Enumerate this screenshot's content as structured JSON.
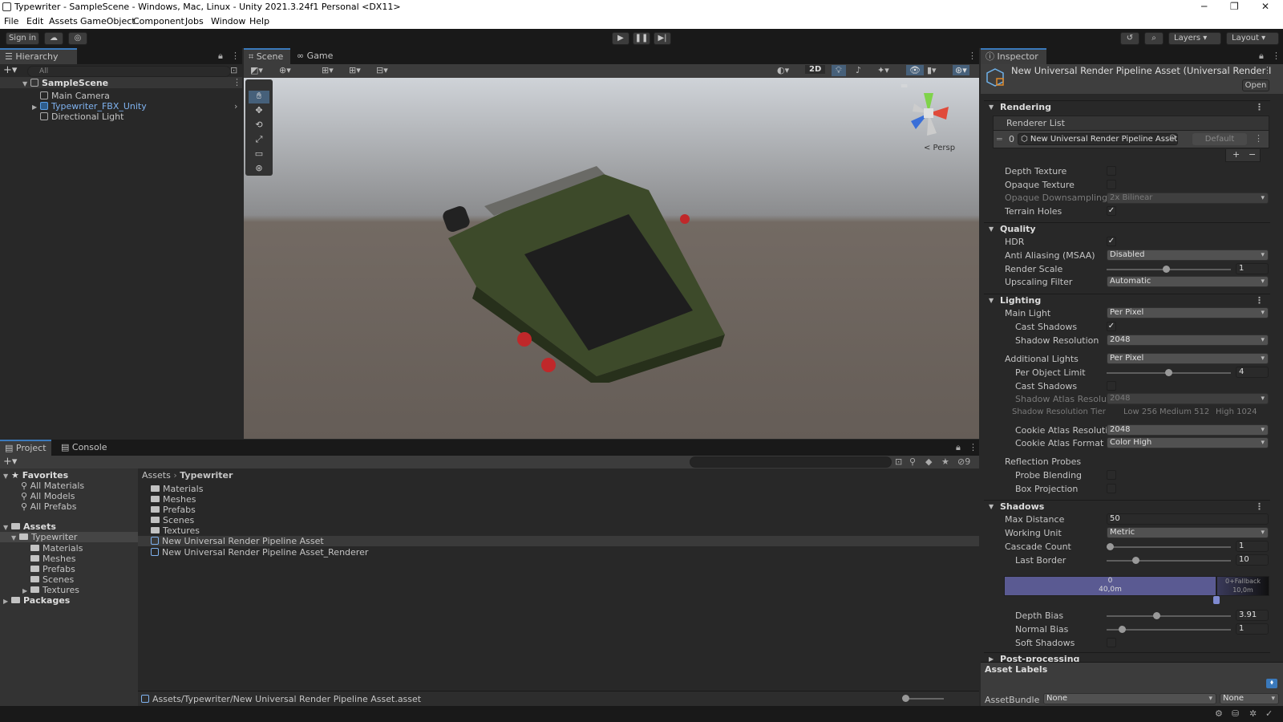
{
  "window": {
    "title": "Typewriter - SampleScene - Windows, Mac, Linux - Unity 2021.3.24f1 Personal <DX11>",
    "controls": [
      "─",
      "❐",
      "✕"
    ]
  },
  "menu": [
    "File",
    "Edit",
    "Assets",
    "GameObject",
    "Component",
    "Jobs",
    "Window",
    "Help"
  ],
  "toolbar": {
    "sign_in": "Sign in",
    "layers": "Layers",
    "layout": "Layout"
  },
  "hierarchy": {
    "tab": "Hierarchy",
    "search_placeholder": "All",
    "scene": "SampleScene",
    "items": [
      "Main Camera",
      "Typewriter_FBX_Unity",
      "Directional Light"
    ]
  },
  "scene_view": {
    "tabs": [
      "Scene",
      "Game"
    ],
    "toggle_2d": "2D",
    "persp": "< Persp",
    "colors": {
      "typewriter_body": "#3d4a2a",
      "keys": "#1e1e1e",
      "accent_keys": "#c0282a"
    }
  },
  "project": {
    "tabs": [
      "Project",
      "Console"
    ],
    "hidden_count": "9",
    "favorites_label": "Favorites",
    "favorites": [
      "All Materials",
      "All Models",
      "All Prefabs"
    ],
    "assets_label": "Assets",
    "typewriter_label": "Typewriter",
    "typewriter_children": [
      "Materials",
      "Meshes",
      "Prefabs",
      "Scenes",
      "Textures"
    ],
    "packages_label": "Packages",
    "breadcrumb": [
      "Assets",
      "Typewriter"
    ],
    "folders": [
      "Materials",
      "Meshes",
      "Prefabs",
      "Scenes",
      "Textures"
    ],
    "assets": [
      "New Universal Render Pipeline Asset",
      "New Universal Render Pipeline Asset_Renderer"
    ],
    "path": "Assets/Typewriter/New Universal Render Pipeline Asset.asset"
  },
  "inspector": {
    "tab": "Inspector",
    "title": "New Universal Render Pipeline Asset (Universal Render I",
    "open_button": "Open",
    "rendering": {
      "header": "Rendering",
      "renderer_list": "Renderer List",
      "renderer_index": "0",
      "renderer_value": "New Universal Render Pipeline Asset_R",
      "default_button": "Default",
      "add": "+",
      "remove": "−",
      "depth_texture": "Depth Texture",
      "opaque_texture": "Opaque Texture",
      "opaque_downsampling": "Opaque Downsampling",
      "opaque_downsampling_value": "2x Bilinear",
      "terrain_holes": "Terrain Holes"
    },
    "quality": {
      "header": "Quality",
      "hdr": "HDR",
      "msaa": "Anti Aliasing (MSAA)",
      "msaa_value": "Disabled",
      "render_scale": "Render Scale",
      "render_scale_value": "1",
      "render_scale_fraction": 0.48,
      "upscaling": "Upscaling Filter",
      "upscaling_value": "Automatic"
    },
    "lighting": {
      "header": "Lighting",
      "main_light": "Main Light",
      "main_light_value": "Per Pixel",
      "cast_shadows": "Cast Shadows",
      "shadow_resolution": "Shadow Resolution",
      "shadow_resolution_value": "2048",
      "additional_lights": "Additional Lights",
      "additional_lights_value": "Per Pixel",
      "per_object_limit": "Per Object Limit",
      "per_object_limit_value": "4",
      "per_object_limit_fraction": 0.5,
      "add_cast_shadows": "Cast Shadows",
      "atlas_resolution": "Shadow Atlas Resolutio",
      "atlas_resolution_value": "2048",
      "tier_label": "Shadow Resolution Tier",
      "tier_low": "Low 256",
      "tier_medium": "Medium 512",
      "tier_high": "High 1024",
      "cookie_atlas_res": "Cookie Atlas Resolution",
      "cookie_atlas_res_value": "2048",
      "cookie_atlas_format": "Cookie Atlas Format",
      "cookie_atlas_format_value": "Color High",
      "reflection_probes": "Reflection Probes",
      "probe_blending": "Probe Blending",
      "box_projection": "Box Projection"
    },
    "shadows": {
      "header": "Shadows",
      "max_distance": "Max Distance",
      "max_distance_value": "50",
      "working_unit": "Working Unit",
      "working_unit_value": "Metric",
      "cascade_count": "Cascade Count",
      "cascade_count_value": "1",
      "cascade_count_fraction": 0.0,
      "last_border": "Last Border",
      "last_border_value": "10",
      "last_border_fraction": 0.22,
      "cascade_index": "0",
      "cascade_distance": "40,0m",
      "fallback_label": "0+Fallback",
      "fallback_distance": "10,0m",
      "depth_bias": "Depth Bias",
      "depth_bias_value": "3.91",
      "depth_bias_fraction": 0.4,
      "normal_bias": "Normal Bias",
      "normal_bias_value": "1",
      "normal_bias_fraction": 0.1,
      "soft_shadows": "Soft Shadows"
    },
    "post_processing": "Post-processing",
    "asset_labels": "Asset Labels",
    "asset_bundle": "AssetBundle",
    "asset_bundle_value": "None",
    "asset_bundle_variant": "None"
  }
}
